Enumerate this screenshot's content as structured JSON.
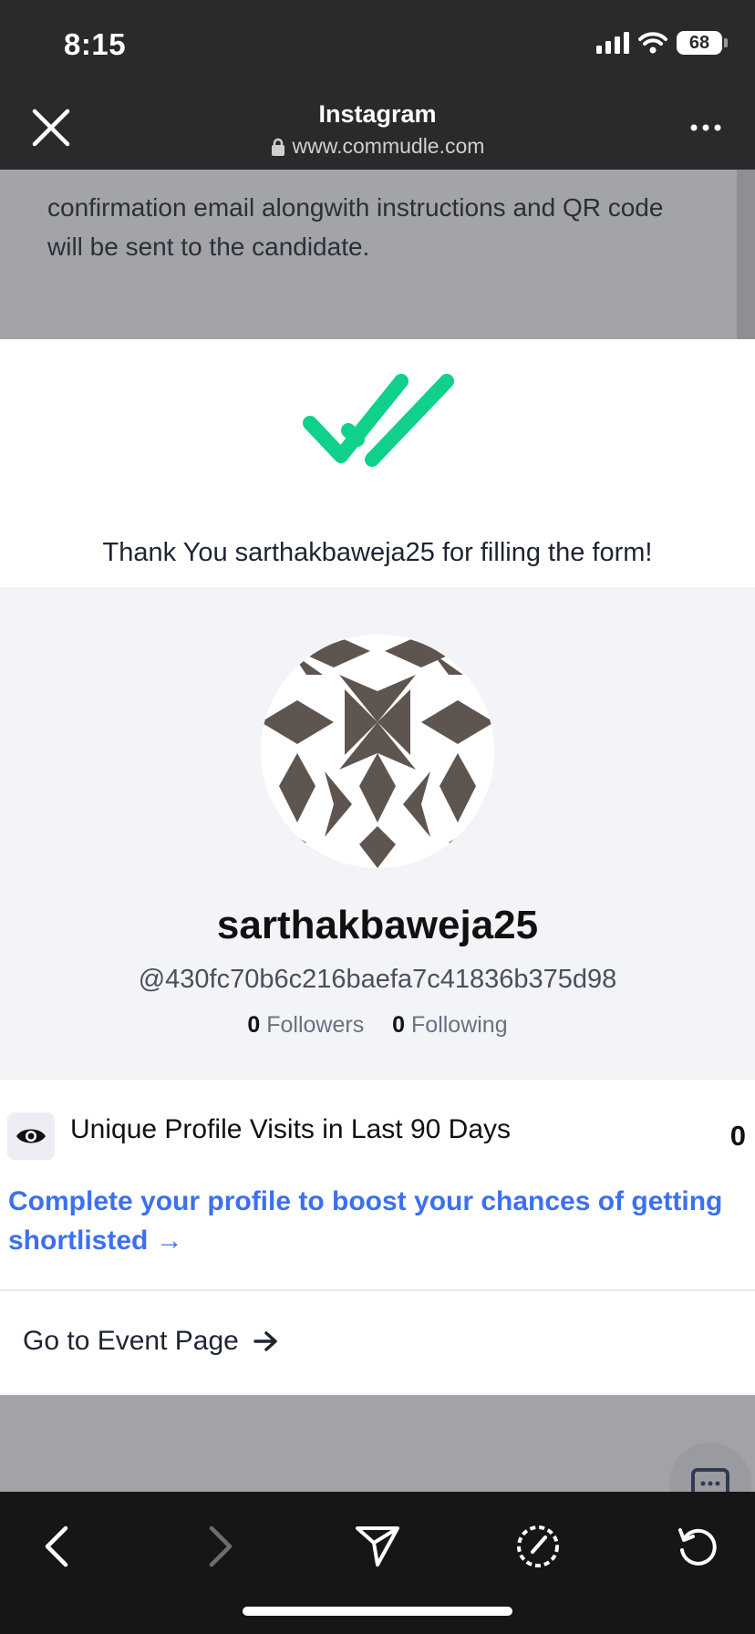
{
  "status_bar": {
    "time": "8:15",
    "battery": "68"
  },
  "browser": {
    "title": "Instagram",
    "url": "www.commudle.com"
  },
  "background_text": "confirmation email alongwith instructions and QR code will be sent to the candidate.",
  "thanks": {
    "message": "Thank You sarthakbaweja25 for filling the form!"
  },
  "profile": {
    "name": "sarthakbaweja25",
    "handle": "@430fc70b6c216baefa7c41836b375d98",
    "followers_count": "0",
    "followers_label": "Followers",
    "following_count": "0",
    "following_label": "Following"
  },
  "visits": {
    "label": "Unique Profile Visits in Last 90 Days",
    "count": "0",
    "complete_link": "Complete your profile to boost your chances of getting shortlisted →"
  },
  "event": {
    "link_label": "Go to Event Page"
  },
  "icons": {
    "close": "close-icon",
    "more": "more-icon",
    "lock": "lock-icon",
    "check": "double-check-icon",
    "eye": "eye-icon",
    "arrow": "arrow-right-icon",
    "chat": "chat-icon",
    "back": "back-icon",
    "forward": "forward-icon",
    "share": "send-icon",
    "safari": "compass-icon",
    "reload": "reload-icon"
  },
  "colors": {
    "accent_green": "#10d18a",
    "link_blue": "#3d70f0",
    "chrome_dark": "#2a2a2c"
  }
}
